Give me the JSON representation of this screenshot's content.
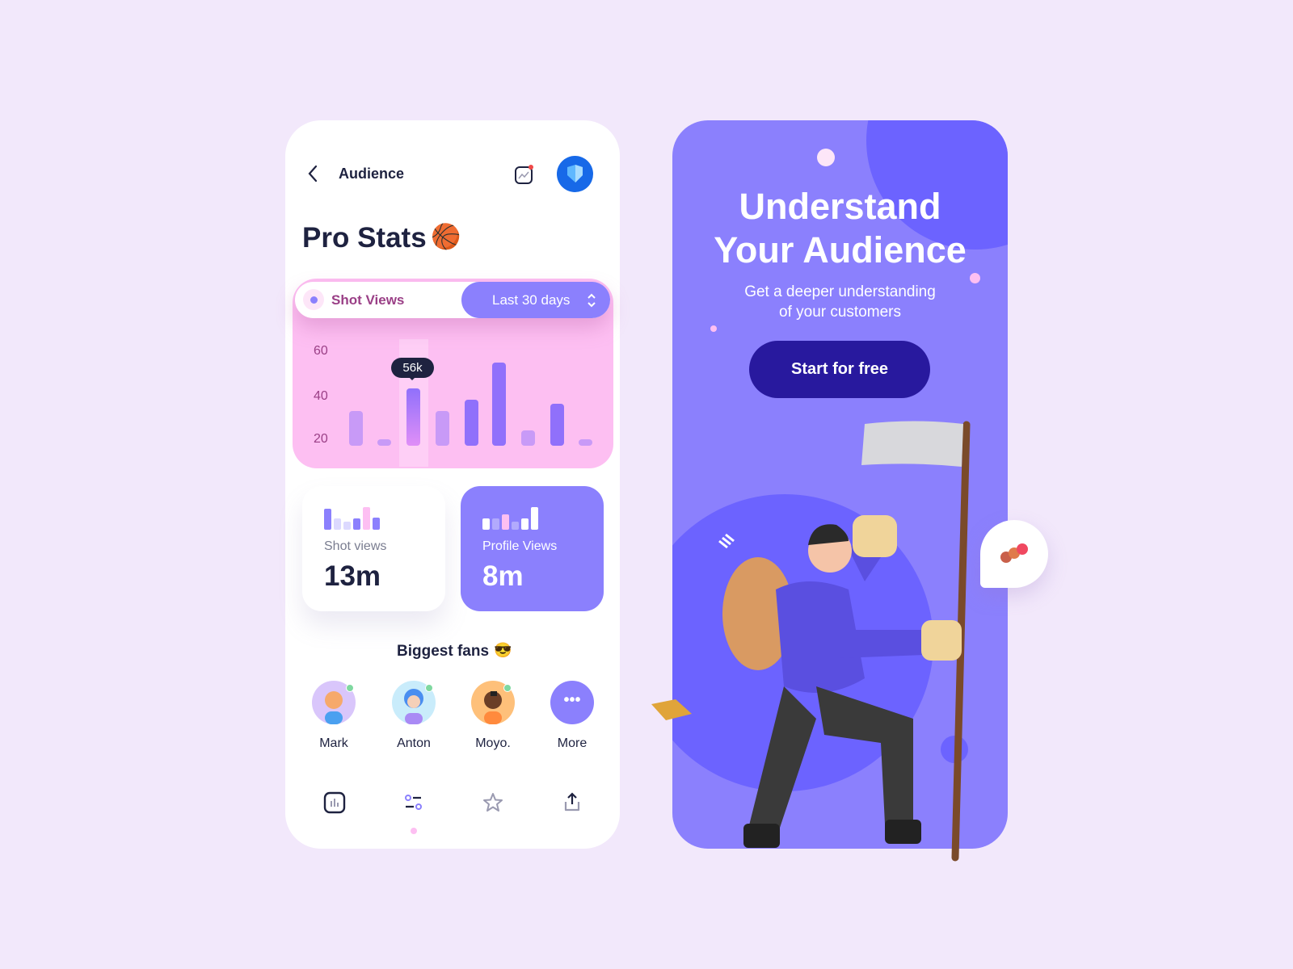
{
  "header": {
    "title": "Audience",
    "back_icon": "chevron-left-icon",
    "activity_icon": "chart-notification-icon",
    "avatar": "shield-logo"
  },
  "page_title": "Pro Stats",
  "page_title_emoji": "🏀",
  "chart_card": {
    "metric_label": "Shot Views",
    "range_select": "Last 30 days",
    "tooltip": "56k"
  },
  "chart_data": {
    "type": "bar",
    "y_ticks": [
      "60",
      "40",
      "20"
    ],
    "values": [
      33,
      20,
      43,
      33,
      38,
      55,
      24,
      36,
      20
    ],
    "highlighted_index": 2,
    "ylim": [
      17,
      60
    ],
    "grid": false,
    "colors": {
      "light": "#c89af7",
      "strong": "#9070fb",
      "highlight": "#e08ff7"
    }
  },
  "stats": [
    {
      "label": "Shot views",
      "value": "13m"
    },
    {
      "label": "Profile Views",
      "value": "8m"
    }
  ],
  "fans": {
    "title": "Biggest fans",
    "emoji": "😎",
    "items": [
      {
        "name": "Mark"
      },
      {
        "name": "Anton"
      },
      {
        "name": "Moyo."
      },
      {
        "name": "More"
      }
    ]
  },
  "nav": [
    "stats-icon",
    "filters-icon",
    "star-icon",
    "share-icon"
  ],
  "promo": {
    "title_line1": "Understand",
    "title_line2": "Your Audience",
    "sub_line1": "Get a deeper understanding",
    "sub_line2": "of your customers",
    "cta": "Start for free"
  },
  "colors": {
    "accent": "#8b80fd",
    "pink": "#fdbff2",
    "navy": "#1e2240",
    "cta": "#28199e"
  }
}
